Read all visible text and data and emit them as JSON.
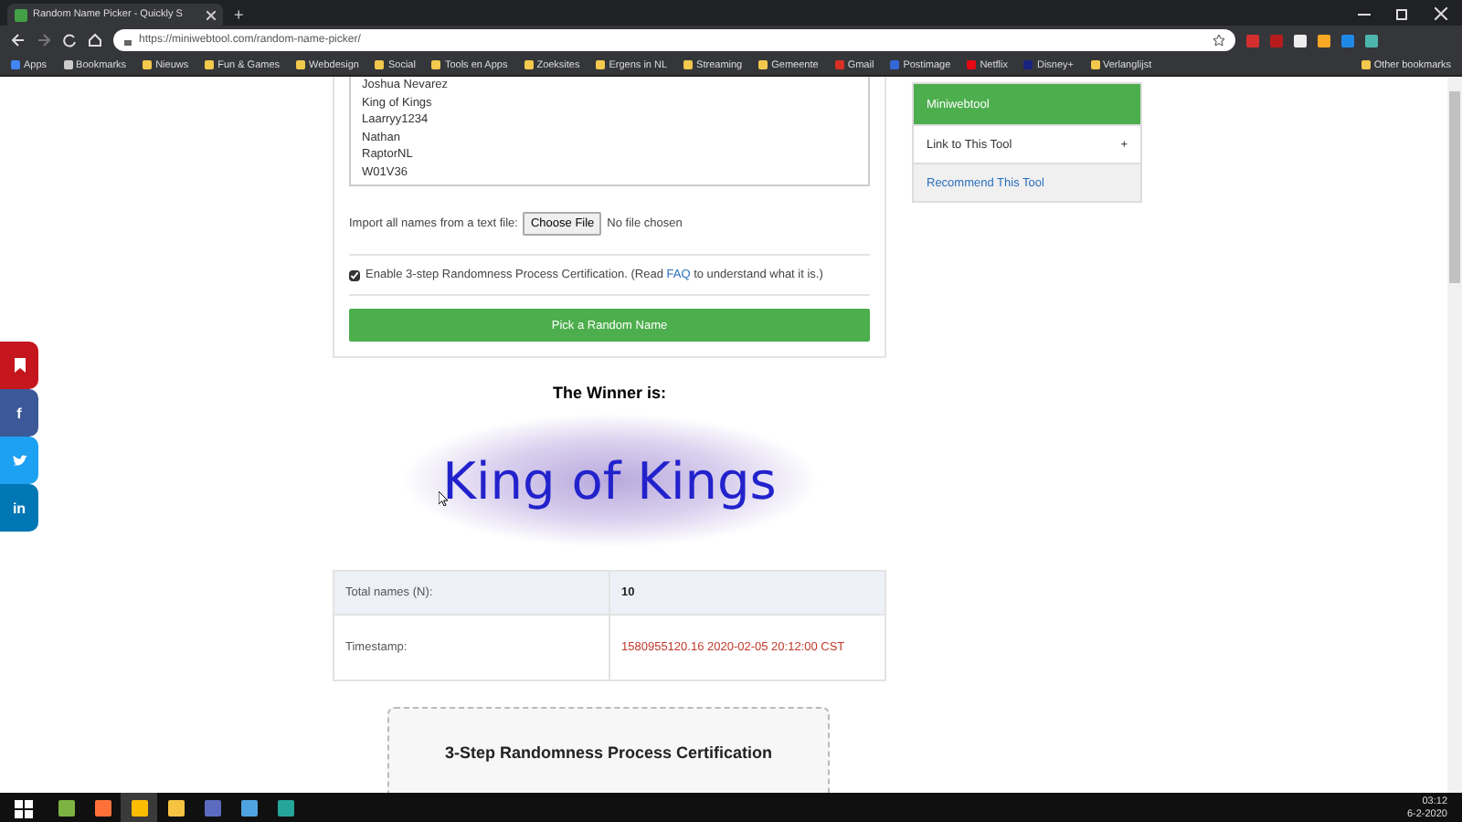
{
  "browser": {
    "tab_title": "Random Name Picker - Quickly S",
    "new_tab": "+",
    "url": "https://miniwebtool.com/random-name-picker/",
    "bookmarks": [
      {
        "kind": "apps",
        "label": "Apps"
      },
      {
        "kind": "star",
        "label": "Bookmarks"
      },
      {
        "kind": "folder",
        "label": "Nieuws"
      },
      {
        "kind": "folder",
        "label": "Fun & Games"
      },
      {
        "kind": "folder",
        "label": "Webdesign"
      },
      {
        "kind": "folder",
        "label": "Social"
      },
      {
        "kind": "folder",
        "label": "Tools en Apps"
      },
      {
        "kind": "folder",
        "label": "Zoeksites"
      },
      {
        "kind": "folder",
        "label": "Ergens in NL"
      },
      {
        "kind": "folder",
        "label": "Streaming"
      },
      {
        "kind": "folder",
        "label": "Gemeente"
      },
      {
        "kind": "mail",
        "label": "Gmail"
      },
      {
        "kind": "site",
        "label": "Postimage"
      },
      {
        "kind": "red",
        "label": "Netflix"
      },
      {
        "kind": "navy",
        "label": "Disney+"
      },
      {
        "kind": "folder",
        "label": "Verlanglijst"
      }
    ],
    "other_bookmarks": "Other bookmarks"
  },
  "share_buttons": [
    {
      "kind": "bookmark",
      "color": "#c4161c"
    },
    {
      "kind": "text",
      "label": "f",
      "color": "#3b5998"
    },
    {
      "kind": "bird",
      "color": "#1da1f2"
    },
    {
      "kind": "text",
      "label": "in",
      "color": "#0077b5"
    }
  ],
  "form": {
    "names": [
      "Joshua Nevarez",
      "King of Kings",
      "Laarryy1234",
      "Nathan",
      "RaptorNL",
      "W01V36"
    ],
    "import_label": "Import all names from a text file:",
    "file_button": "Choose File",
    "file_status": "No file chosen",
    "certification": {
      "checked": true,
      "text_before": "Enable 3-step Randomness Process Certification. (Read ",
      "link": "FAQ",
      "text_after": " to understand what it is.)"
    },
    "pick_button": "Pick a Random Name"
  },
  "result": {
    "heading": "The Winner is:",
    "winner": "King of Kings",
    "rows": [
      {
        "label": "Total names (N):",
        "value": "10",
        "kind": "count"
      },
      {
        "label": "Timestamp:",
        "value": "1580955120.16 2020-02-05 20:12:00 CST",
        "kind": "stamp"
      }
    ]
  },
  "certification_box": {
    "heading": "3-Step Randomness Process Certification"
  },
  "sidebar": {
    "header": "Miniwebtool",
    "items": [
      {
        "label": "Link to This Tool",
        "kind": "expand",
        "toggle": "+"
      },
      {
        "label": "Recommend This Tool",
        "kind": "link"
      }
    ]
  },
  "taskbar": {
    "apps": [
      {
        "kind": "notepad",
        "selected": false
      },
      {
        "kind": "firefox",
        "selected": false
      },
      {
        "kind": "chrome",
        "selected": true
      },
      {
        "kind": "explorer",
        "selected": false
      },
      {
        "kind": "window",
        "selected": false
      },
      {
        "kind": "check",
        "selected": false
      },
      {
        "kind": "app",
        "selected": false
      }
    ],
    "time": "03:12",
    "date": "6-2-2020"
  }
}
